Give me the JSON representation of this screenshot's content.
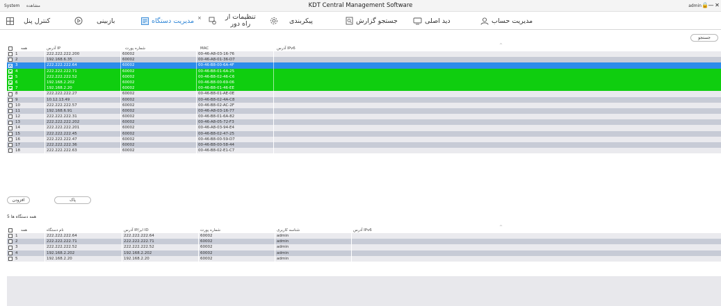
{
  "titlebar": {
    "system_label": "System",
    "view_label": "مشاهده",
    "app_title": "KDT Central Management Software",
    "user": "admin",
    "lock_glyph": "🔒",
    "minimize_glyph": "—",
    "close_glyph": "✕"
  },
  "nav": {
    "account": "مدیریت حساب",
    "main_view": "دید اصلی",
    "report": "جستجو گزارش",
    "config": "پیکربندی",
    "settings_line1": "تنظیمات از",
    "settings_line2": "راه دور",
    "close_tab": "×",
    "device_mgmt": "مدیریت دستگاه",
    "playback": "بازبینی",
    "panel_control": "کنترل پنل"
  },
  "search": {
    "label": "جستجو"
  },
  "top_table": {
    "headers": {
      "all": "همه",
      "ip": "آدرس IP",
      "port": "شماره پورت",
      "mac": "MAC",
      "ipv6": "آدرس IPv6"
    },
    "sort_caret": "^",
    "rows": [
      {
        "num": "1",
        "ip": "222.222.222.200",
        "port": "60002",
        "mac": "00-46-A8-03-16-76",
        "state": "odd",
        "checked": false
      },
      {
        "num": "2",
        "ip": "192.168.6.35",
        "port": "60002",
        "mac": "00-46-A8-01-36-D7",
        "state": "even",
        "checked": false
      },
      {
        "num": "3",
        "ip": "222.222.222.64",
        "port": "60002",
        "mac": "00-46-B8-00-6A-4F",
        "state": "sel",
        "checked": true
      },
      {
        "num": "4",
        "ip": "222.222.222.71",
        "port": "60002",
        "mac": "00-46-B8-01-6A-25",
        "state": "green",
        "checked": true
      },
      {
        "num": "5",
        "ip": "222.222.222.52",
        "port": "60002",
        "mac": "00-46-B8-02-46-C6",
        "state": "green",
        "checked": true
      },
      {
        "num": "6",
        "ip": "192.168.2.202",
        "port": "60002",
        "mac": "00-46-B8-00-69-06",
        "state": "green",
        "checked": true
      },
      {
        "num": "7",
        "ip": "192.168.2.20",
        "port": "60002",
        "mac": "00-46-B8-01-46-EE",
        "state": "green",
        "checked": true
      },
      {
        "num": "8",
        "ip": "222.222.222.27",
        "port": "60002",
        "mac": "00-46-B8-01-AE-0E",
        "state": "odd",
        "checked": false
      },
      {
        "num": "9",
        "ip": "10.12.13.49",
        "port": "60002",
        "mac": "00-46-B8-02-4A-C8",
        "state": "even",
        "checked": false
      },
      {
        "num": "10",
        "ip": "222.222.222.57",
        "port": "60002",
        "mac": "00-46-B8-02-AC-2F",
        "state": "odd",
        "checked": false
      },
      {
        "num": "11",
        "ip": "192.168.6.91",
        "port": "60002",
        "mac": "00-46-A8-03-16-77",
        "state": "even",
        "checked": false
      },
      {
        "num": "12",
        "ip": "222.222.222.31",
        "port": "60002",
        "mac": "00-46-B8-01-6A-82",
        "state": "odd",
        "checked": false
      },
      {
        "num": "13",
        "ip": "222.222.222.202",
        "port": "60002",
        "mac": "00-46-A8-05-72-F3",
        "state": "even",
        "checked": false
      },
      {
        "num": "14",
        "ip": "222.222.222.201",
        "port": "60002",
        "mac": "00-46-A8-03-94-E4",
        "state": "odd",
        "checked": false
      },
      {
        "num": "15",
        "ip": "222.222.222.45",
        "port": "60002",
        "mac": "00-46-B8-02-47-25",
        "state": "even",
        "checked": false
      },
      {
        "num": "16",
        "ip": "222.222.222.47",
        "port": "60002",
        "mac": "00-46-B8-00-59-D7",
        "state": "odd",
        "checked": false
      },
      {
        "num": "17",
        "ip": "222.222.222.36",
        "port": "60002",
        "mac": "00-46-B8-00-58-44",
        "state": "even",
        "checked": false
      },
      {
        "num": "18",
        "ip": "222.222.222.63",
        "port": "60002",
        "mac": "00-46-B8-02-E1-C7",
        "state": "odd",
        "checked": false
      }
    ]
  },
  "buttons": {
    "add": "افزودن",
    "clear": "پاک"
  },
  "bottom_section": {
    "label": "5 همه دستگاه ها"
  },
  "bottom_table": {
    "headers": {
      "all": "همه",
      "name": "نام دستگاه",
      "ip_id": "آدرس IP/ابر ID",
      "port": "شماره پورت",
      "user_id": "شناسه کاربری",
      "ipv6": "آدرس IPv6"
    },
    "sort_caret": "^",
    "rows": [
      {
        "num": "1",
        "name": "222.222.222.64",
        "ip_id": "222.222.222.64",
        "port": "60002",
        "user_id": "admin",
        "state": "odd"
      },
      {
        "num": "2",
        "name": "222.222.222.71",
        "ip_id": "222.222.222.71",
        "port": "60002",
        "user_id": "admin",
        "state": "even"
      },
      {
        "num": "3",
        "name": "222.222.222.52",
        "ip_id": "222.222.222.52",
        "port": "60002",
        "user_id": "admin",
        "state": "odd"
      },
      {
        "num": "4",
        "name": "192.168.2.202",
        "ip_id": "192.168.2.202",
        "port": "60002",
        "user_id": "admin",
        "state": "even"
      },
      {
        "num": "5",
        "name": "192.168.2.20",
        "ip_id": "192.168.2.20",
        "port": "60002",
        "user_id": "admin",
        "state": "odd"
      }
    ]
  },
  "colors": {
    "selected_row": "#2c8ceb",
    "added_row": "#0fce0f",
    "active_tab": "#2f86d6"
  }
}
